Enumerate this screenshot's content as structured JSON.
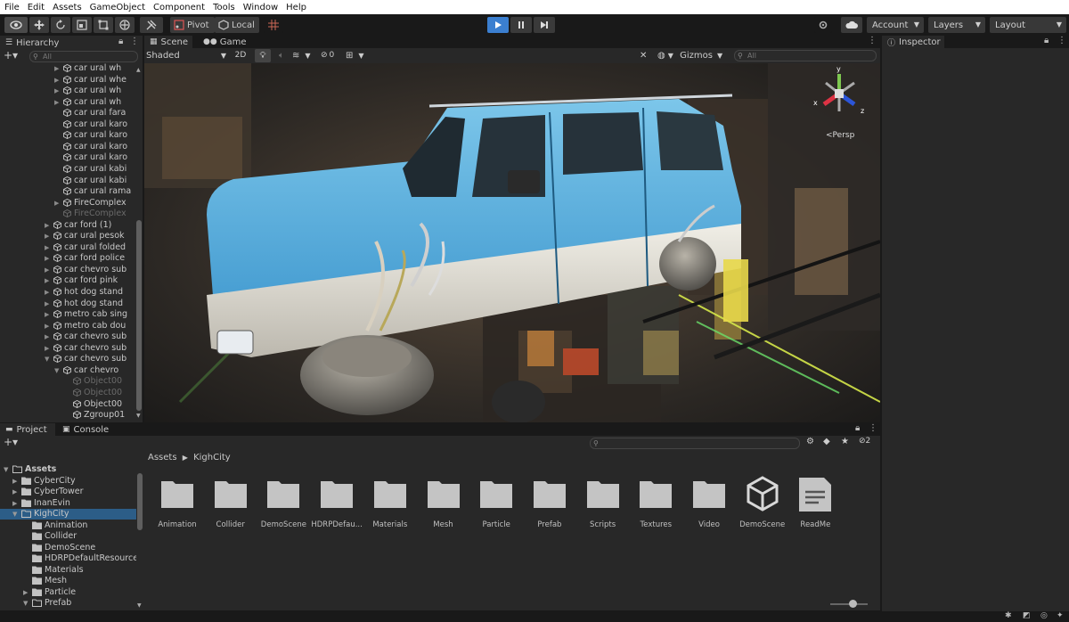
{
  "menu": [
    "File",
    "Edit",
    "Assets",
    "GameObject",
    "Component",
    "Tools",
    "Window",
    "Help"
  ],
  "toolbar": {
    "pivot_label": "Pivot",
    "local_label": "Local",
    "account_label": "Account",
    "layers_label": "Layers",
    "layout_label": "Layout"
  },
  "hierarchy": {
    "title": "Hierarchy",
    "search_placeholder": "All",
    "items": [
      {
        "label": "car ural wh",
        "dim": false
      },
      {
        "label": "car ural whe",
        "dim": false
      },
      {
        "label": "car ural wh",
        "dim": false
      },
      {
        "label": "car ural wh",
        "dim": false
      },
      {
        "label": "car ural fara",
        "dim": false
      },
      {
        "label": "car ural karo",
        "dim": false
      },
      {
        "label": "car ural karo",
        "dim": false
      },
      {
        "label": "car ural karo",
        "dim": false
      },
      {
        "label": "car ural karo",
        "dim": false
      },
      {
        "label": "car ural kabi",
        "dim": false
      },
      {
        "label": "car ural kabi",
        "dim": false
      },
      {
        "label": "car ural rama",
        "dim": false
      },
      {
        "label": "FireComplex",
        "dim": false
      },
      {
        "label": "FireComplex",
        "dim": true
      },
      {
        "label": "car ford (1)",
        "dim": false
      },
      {
        "label": "car ural pesok",
        "dim": false
      },
      {
        "label": "car ural folded",
        "dim": false
      },
      {
        "label": "car ford police",
        "dim": false
      },
      {
        "label": "car chevro sub",
        "dim": false
      },
      {
        "label": "car ford pink",
        "dim": false
      },
      {
        "label": "hot dog stand",
        "dim": false
      },
      {
        "label": "hot dog stand",
        "dim": false
      },
      {
        "label": "metro cab sing",
        "dim": false
      },
      {
        "label": "metro cab dou",
        "dim": false
      },
      {
        "label": "car chevro sub",
        "dim": false
      },
      {
        "label": "car chevro sub",
        "dim": false
      },
      {
        "label": "car chevro sub",
        "dim": false
      },
      {
        "label": "car chevro",
        "dim": false
      },
      {
        "label": "Object00",
        "dim": true
      },
      {
        "label": "Object00",
        "dim": true
      },
      {
        "label": "Object00",
        "dim": false
      },
      {
        "label": "Zgroup01",
        "dim": false
      }
    ]
  },
  "scene": {
    "tab_scene": "Scene",
    "tab_game": "Game",
    "shading": "Shaded",
    "mode_2d": "2D",
    "hidden_count": "0",
    "gizmos": "Gizmos",
    "search_placeholder": "All",
    "persp": "Persp",
    "axis_x": "x",
    "axis_y": "y",
    "axis_z": "z"
  },
  "inspector": {
    "title": "Inspector"
  },
  "project": {
    "tab_project": "Project",
    "tab_console": "Console",
    "badge_count": "2",
    "breadcrumb_root": "Assets",
    "breadcrumb_current": "KighCity",
    "tree": [
      {
        "label": "Assets",
        "level": 0,
        "open": true,
        "selected": false
      },
      {
        "label": "CyberCity",
        "level": 1,
        "open": false,
        "selected": false
      },
      {
        "label": "CyberTower",
        "level": 1,
        "open": false,
        "selected": false
      },
      {
        "label": "InanEvin",
        "level": 1,
        "open": false,
        "selected": false
      },
      {
        "label": "KighCity",
        "level": 1,
        "open": true,
        "selected": true
      },
      {
        "label": "Animation",
        "level": 2,
        "open": false,
        "selected": false
      },
      {
        "label": "Collider",
        "level": 2,
        "open": false,
        "selected": false
      },
      {
        "label": "DemoScene",
        "level": 2,
        "open": false,
        "selected": false
      },
      {
        "label": "HDRPDefaultResource",
        "level": 2,
        "open": false,
        "selected": false
      },
      {
        "label": "Materials",
        "level": 2,
        "open": false,
        "selected": false
      },
      {
        "label": "Mesh",
        "level": 2,
        "open": false,
        "selected": false
      },
      {
        "label": "Particle",
        "level": 2,
        "open": false,
        "selected": false
      },
      {
        "label": "Prefab",
        "level": 2,
        "open": true,
        "selected": false
      }
    ],
    "items": [
      {
        "label": "Animation",
        "icon": "folder-icon"
      },
      {
        "label": "Collider",
        "icon": "folder-icon"
      },
      {
        "label": "DemoScene",
        "icon": "folder-icon"
      },
      {
        "label": "HDRPDefau...",
        "icon": "folder-icon"
      },
      {
        "label": "Materials",
        "icon": "folder-icon"
      },
      {
        "label": "Mesh",
        "icon": "folder-icon"
      },
      {
        "label": "Particle",
        "icon": "folder-icon"
      },
      {
        "label": "Prefab",
        "icon": "folder-icon"
      },
      {
        "label": "Scripts",
        "icon": "folder-icon"
      },
      {
        "label": "Textures",
        "icon": "folder-icon"
      },
      {
        "label": "Video",
        "icon": "folder-icon"
      },
      {
        "label": "DemoScene",
        "icon": "unity-scene-icon"
      },
      {
        "label": "ReadMe",
        "icon": "document-icon"
      }
    ]
  },
  "colors": {
    "accent_play": "#3b7fd0",
    "selection": "#2c5d87",
    "truck_blue": "#4aa6d9"
  }
}
